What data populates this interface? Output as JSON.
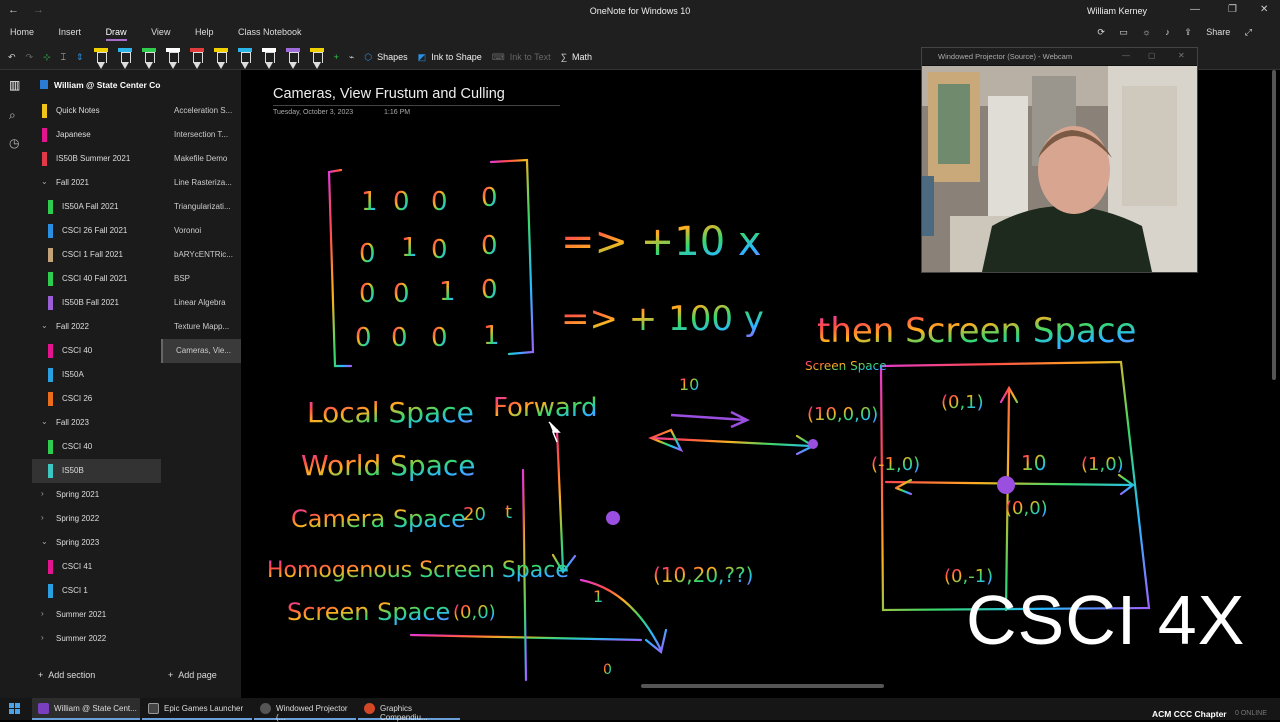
{
  "titlebar": {
    "app_title": "OneNote for Windows 10",
    "user": "William Kerney",
    "back": "←",
    "forward": "→",
    "minimize": "—",
    "maximize": "❐",
    "close": "✕"
  },
  "ribbon": {
    "tabs": [
      "Home",
      "Insert",
      "Draw",
      "View",
      "Help",
      "Class Notebook"
    ],
    "active_tab": "Draw",
    "share": "Share",
    "tools": {
      "shapes": "Shapes",
      "ink_to_shape": "Ink to Shape",
      "ink_to_text": "Ink to Text",
      "math": "Math"
    },
    "pen_colors": [
      "#f0d000",
      "#2bb5e8",
      "#2fcc50",
      "#ffffff",
      "#e23b3b",
      "#f0d000",
      "#2bb5e8",
      "#ffffff",
      "#a06cdb"
    ]
  },
  "notebook": {
    "name": "William @ State Center Commun..."
  },
  "sections": [
    {
      "label": "Quick Notes",
      "color": "#f0c419",
      "indent": 0,
      "group": false
    },
    {
      "label": "Japanese",
      "color": "#e4148f",
      "indent": 0,
      "group": false
    },
    {
      "label": "IS50B Summer 2021",
      "color": "#e03a4a",
      "indent": 0,
      "group": false
    },
    {
      "label": "Fall 2021",
      "color": "",
      "indent": 0,
      "group": true,
      "expanded": true
    },
    {
      "label": "IS50A Fall 2021",
      "color": "#2fcc50",
      "indent": 1,
      "group": false
    },
    {
      "label": "CSCI 26 Fall 2021",
      "color": "#2a8fe0",
      "indent": 1,
      "group": false
    },
    {
      "label": "CSCI 1 Fall 2021",
      "color": "#c2a37a",
      "indent": 1,
      "group": false
    },
    {
      "label": "CSCI 40 Fall 2021",
      "color": "#2fcc50",
      "indent": 1,
      "group": false
    },
    {
      "label": "IS50B Fall 2021",
      "color": "#9a5fd4",
      "indent": 1,
      "group": false
    },
    {
      "label": "Fall 2022",
      "color": "",
      "indent": 0,
      "group": true,
      "expanded": true
    },
    {
      "label": "CSCI 40",
      "color": "#e4148f",
      "indent": 1,
      "group": false
    },
    {
      "label": "IS50A",
      "color": "#2aa0e0",
      "indent": 1,
      "group": false
    },
    {
      "label": "CSCI 26",
      "color": "#e86d1c",
      "indent": 1,
      "group": false
    },
    {
      "label": "Fall 2023",
      "color": "",
      "indent": 0,
      "group": true,
      "expanded": true
    },
    {
      "label": "CSCI 40",
      "color": "#2fcc50",
      "indent": 1,
      "group": false
    },
    {
      "label": "IS50B",
      "color": "#3cc8c0",
      "indent": 1,
      "group": false,
      "selected": true
    },
    {
      "label": "Spring 2021",
      "color": "",
      "indent": 0,
      "group": true,
      "expanded": false
    },
    {
      "label": "Spring 2022",
      "color": "",
      "indent": 0,
      "group": true,
      "expanded": false
    },
    {
      "label": "Spring 2023",
      "color": "",
      "indent": 0,
      "group": true,
      "expanded": true
    },
    {
      "label": "CSCI 41",
      "color": "#e4148f",
      "indent": 1,
      "group": false
    },
    {
      "label": "CSCI 1",
      "color": "#2aa0e0",
      "indent": 1,
      "group": false
    },
    {
      "label": "Summer 2021",
      "color": "",
      "indent": 0,
      "group": true,
      "expanded": false
    },
    {
      "label": "Summer 2022",
      "color": "",
      "indent": 0,
      "group": true,
      "expanded": false
    }
  ],
  "pages": [
    {
      "label": "Acceleration S..."
    },
    {
      "label": "Intersection T..."
    },
    {
      "label": "Makefile Demo"
    },
    {
      "label": "Line Rasteriza..."
    },
    {
      "label": "Triangularizati..."
    },
    {
      "label": "Voronoi"
    },
    {
      "label": "bARYcENTRic..."
    },
    {
      "label": "BSP"
    },
    {
      "label": "Linear Algebra"
    },
    {
      "label": "Texture Mapp..."
    },
    {
      "label": "Cameras, Vie...",
      "selected": true
    }
  ],
  "add_section": "Add section",
  "add_page": "Add page",
  "page": {
    "title": "Cameras, View Frustum and Culling",
    "date": "Tuesday, October 3, 2023",
    "time": "1:16 PM"
  },
  "ink": {
    "matrix": [
      [
        "1",
        "0",
        "0",
        "0"
      ],
      [
        "0",
        "1",
        "0",
        "0"
      ],
      [
        "0",
        "0",
        "1",
        "0"
      ],
      [
        "0",
        "0",
        "0",
        "1"
      ]
    ],
    "labels": [
      "=> +10 x",
      "=> + 100 y",
      "then Screen Space",
      "Local Space",
      "Forward",
      "World Space",
      "Camera Space",
      "Homogenous Screen Space",
      "Screen Space",
      "(10,0,0)",
      "(0,1)",
      "(-1,0)",
      "(1,0)",
      "(0,0)",
      "(0,-1)",
      "10",
      "(10,20,??)",
      "(0,0)",
      "1",
      "0",
      "20",
      "10",
      "t",
      "Screen Space"
    ]
  },
  "projector": {
    "title": "Windowed Projector (Source) - Webcam"
  },
  "watermark": "CSCI 4X",
  "taskbar": {
    "items": [
      {
        "label": "William @ State Cent...",
        "color": "#7a3fbf"
      },
      {
        "label": "Epic Games Launcher",
        "color": "#333333"
      },
      {
        "label": "Windowed Projector (...",
        "color": "#444444"
      },
      {
        "label": "Graphics Compendiu...",
        "color": "#d24726"
      }
    ],
    "tray": "ACM CCC Chapter",
    "tray_status": "0 ONLINE"
  }
}
